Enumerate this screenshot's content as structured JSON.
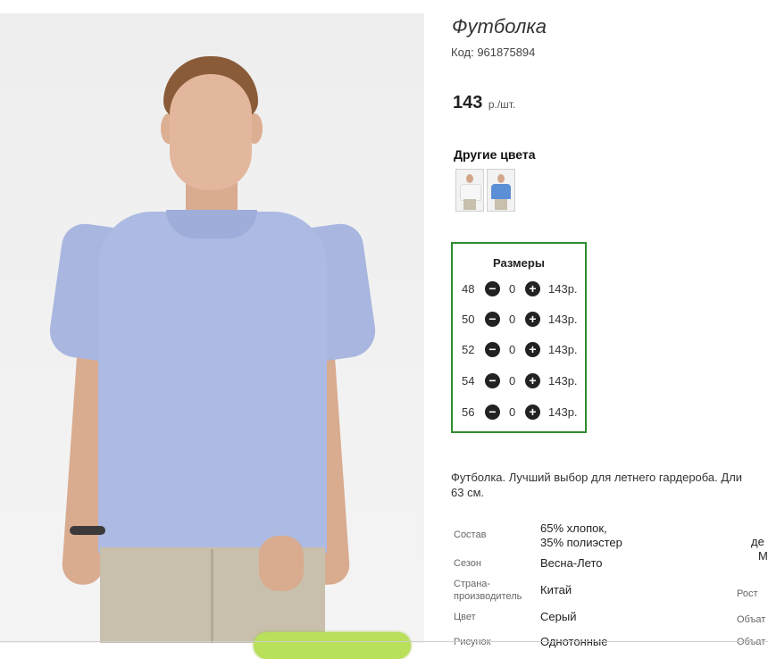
{
  "product": {
    "title": "Футболка",
    "code": "Код: 961875894",
    "price_value": "143",
    "price_unit": "р./шт."
  },
  "colors": {
    "label": "Другие цвета",
    "swatches": [
      {
        "name": "white",
        "shirt_color": "#f7f7f7"
      },
      {
        "name": "blue",
        "shirt_color": "#5a8fd6"
      }
    ]
  },
  "sizes": {
    "title": "Размеры",
    "border_color": "#2e8b2e",
    "rows": [
      {
        "size": "48",
        "minus": "−",
        "qty": "0",
        "plus": "+",
        "price": "143р."
      },
      {
        "size": "50",
        "minus": "−",
        "qty": "0",
        "plus": "+",
        "price": "143р."
      },
      {
        "size": "52",
        "minus": "−",
        "qty": "0",
        "plus": "+",
        "price": "143р."
      },
      {
        "size": "54",
        "minus": "−",
        "qty": "0",
        "plus": "+",
        "price": "143р."
      },
      {
        "size": "56",
        "minus": "−",
        "qty": "0",
        "plus": "+",
        "price": "143р."
      }
    ]
  },
  "description": {
    "line1": "Футболка. Лучший выбор для летнего гардероба. Дли",
    "line2": "63 см."
  },
  "specs": {
    "composition_label": "Состав",
    "composition_value_1": "65% хлопок,",
    "composition_value_2": "35% полиэстер",
    "season_label": "Сезон",
    "season_value": "Весна-Лето",
    "country_label_1": "Страна-",
    "country_label_2": "производитель",
    "country_value": "Китай",
    "color_label": "Цвет",
    "color_value": "Серый",
    "pattern_label": "Рисунок",
    "pattern_value": "Однотонные",
    "right_1": "де",
    "right_2": "М",
    "height_label": "Рост",
    "volume_label": "Объат",
    "volume_label_2": "Объат"
  }
}
